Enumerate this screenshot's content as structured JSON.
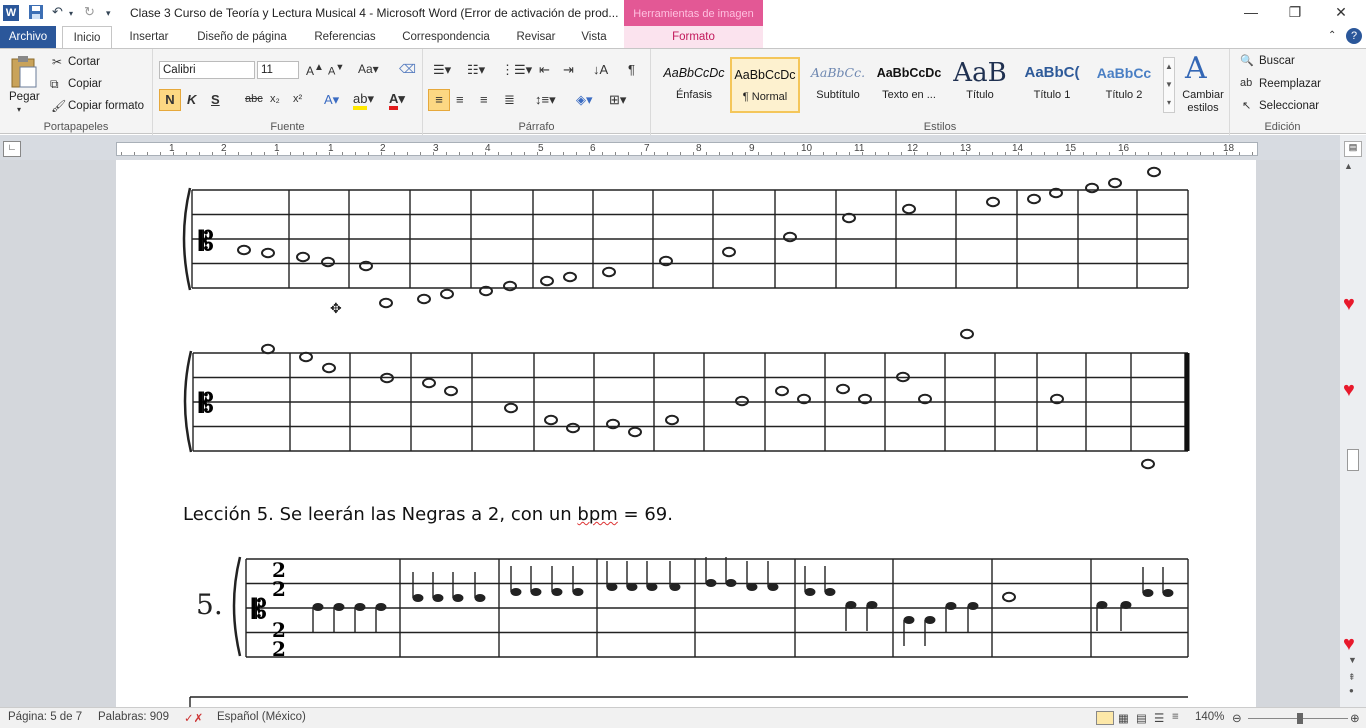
{
  "titlebar": {
    "title": "Clase 3 Curso de Teoría y Lectura Musical 4  -  Microsoft Word (Error de activación de prod...",
    "context_tab_title": "Herramientas de imagen",
    "app_icon": "W"
  },
  "tabs": [
    {
      "label": "Archivo"
    },
    {
      "label": "Inicio"
    },
    {
      "label": "Insertar"
    },
    {
      "label": "Diseño de página"
    },
    {
      "label": "Referencias"
    },
    {
      "label": "Correspondencia"
    },
    {
      "label": "Revisar"
    },
    {
      "label": "Vista"
    },
    {
      "label": "Formato"
    }
  ],
  "ribbon": {
    "clipboard": {
      "paste": "Pegar",
      "cut": "Cortar",
      "copy": "Copiar",
      "format_painter": "Copiar formato",
      "label": "Portapapeles"
    },
    "font": {
      "family": "Calibri",
      "size": "11",
      "label": "Fuente",
      "bold": "N",
      "italic": "K",
      "underline": "S",
      "strike": "abc",
      "subscript": "x₂",
      "superscript": "x²"
    },
    "paragraph": {
      "label": "Párrafo"
    },
    "styles": {
      "label": "Estilos",
      "items": [
        {
          "preview": "AaBbCcDc",
          "name": "Énfasis"
        },
        {
          "preview": "AaBbCcDc",
          "name": "¶ Normal"
        },
        {
          "preview": "AaBbCc.",
          "name": "Subtítulo"
        },
        {
          "preview": "AaBbCcDc",
          "name": "Texto en ..."
        },
        {
          "preview": "AaB",
          "name": "Título"
        },
        {
          "preview": "AaBbC(",
          "name": "Título 1"
        },
        {
          "preview": "AaBbCc",
          "name": "Título 2"
        }
      ],
      "change_styles": "Cambiar estilos"
    },
    "editing": {
      "find": "Buscar",
      "replace": "Reemplazar",
      "select": "Seleccionar",
      "label": "Edición"
    }
  },
  "ruler": {
    "numbers": [
      "1",
      "2",
      "1",
      "1",
      "2",
      "3",
      "4",
      "5",
      "6",
      "7",
      "8",
      "9",
      "10",
      "11",
      "12",
      "13",
      "14",
      "15",
      "16",
      "18"
    ]
  },
  "document": {
    "lesson_prefix": "Lección 5. Se leerán las Negras a 2, con un ",
    "lesson_bpm": "bpm",
    "lesson_suffix": " = 69.",
    "score_number": "5.",
    "time_sig": "2"
  },
  "statusbar": {
    "page": "Página: 5 de 7",
    "words": "Palabras: 909",
    "language": "Español (México)",
    "zoom": "140%"
  },
  "colors": {
    "file_tab": "#2b579a",
    "context_tab": "#e0468a",
    "heart": "#e8192c"
  }
}
